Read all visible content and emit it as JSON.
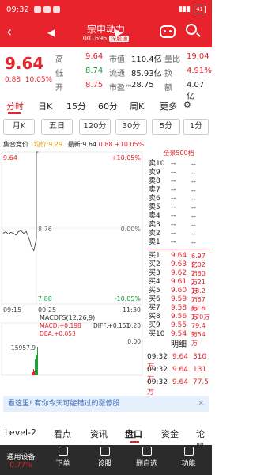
{
  "status": {
    "time": "09:32",
    "battery": "41"
  },
  "header": {
    "title": "宗申动力",
    "code": "001696",
    "tag": "深股通"
  },
  "quote": {
    "price": "9.64",
    "change": "0.88",
    "change_pct": "10.05%",
    "rows": [
      {
        "l1": "高",
        "v1": "9.64",
        "l2": "市值",
        "v2": "110.4亿",
        "l3": "量比",
        "v3": "19.04"
      },
      {
        "l1": "低",
        "v1": "8.74",
        "l2": "流通",
        "v2": "85.93亿",
        "l3": "换",
        "v3": "4.91%"
      },
      {
        "l1": "开",
        "v1": "8.75",
        "l2": "市盈™",
        "v2": "28.75",
        "l3": "额",
        "v3": "4.07亿"
      }
    ]
  },
  "tabs": [
    "分时",
    "日K",
    "15分",
    "60分",
    "周K",
    "更多"
  ],
  "periods": [
    "月K",
    "五日",
    "120分",
    "30分",
    "5分",
    "1分"
  ],
  "chart_info": {
    "auction": "集合竞价",
    "avg": "均价:9.29",
    "latest": "最新:9.64",
    "chg": "0.88",
    "pct": "+10.05%"
  },
  "chart_data": {
    "type": "line",
    "ylim": [
      7.88,
      9.64
    ],
    "y_labels": {
      "top": "9.64",
      "mid": "8.76",
      "bottom": "7.88"
    },
    "pct_labels": {
      "top": "+10.05%",
      "mid": "0.00%",
      "bottom": "-10.05%"
    },
    "x_labels": [
      "09:15",
      "09:25",
      "11:30"
    ],
    "series": [
      {
        "values": [
          8.7,
          8.72,
          8.69,
          8.71,
          8.7,
          8.68,
          8.72,
          8.73,
          8.7,
          8.72,
          8.65,
          8.55,
          8.5,
          8.63,
          9.64,
          9.64,
          9.64
        ]
      }
    ]
  },
  "volume": {
    "max": "15957.9",
    "label": "MACDFS(12,26,9)",
    "macd": "MACD:+0.198",
    "diff": "DIFF:+0.151",
    "dea": "DEA:+0.053",
    "v_top": "0.20",
    "v_zero": "0.00"
  },
  "book": {
    "header": "全景500档",
    "sells": [
      [
        "卖10",
        "--",
        "--"
      ],
      [
        "卖9",
        "--",
        "--"
      ],
      [
        "卖8",
        "--",
        "--"
      ],
      [
        "卖7",
        "--",
        "--"
      ],
      [
        "卖6",
        "--",
        "--"
      ],
      [
        "卖5",
        "--",
        "--"
      ],
      [
        "卖4",
        "--",
        "--"
      ],
      [
        "卖3",
        "--",
        "--"
      ],
      [
        "卖2",
        "--",
        "--"
      ],
      [
        "卖1",
        "--",
        "--"
      ]
    ],
    "buys": [
      [
        "买1",
        "9.64",
        "6.97亿"
      ],
      [
        "买2",
        "9.63",
        "2.02万"
      ],
      [
        "买3",
        "9.62",
        "2.60万"
      ],
      [
        "买4",
        "9.61",
        "2.21万"
      ],
      [
        "买5",
        "9.60",
        "18.2万"
      ],
      [
        "买6",
        "9.59",
        "7.67万"
      ],
      [
        "买7",
        "9.58",
        "62.6万"
      ],
      [
        "买8",
        "9.56",
        "170万"
      ],
      [
        "买9",
        "9.55",
        "79.4万"
      ],
      [
        "买10",
        "9.54",
        "9.54万"
      ]
    ]
  },
  "details": {
    "label": "明细",
    "rows": [
      [
        "09:32",
        "9.64",
        "310万"
      ],
      [
        "09:32",
        "9.64",
        "131万"
      ],
      [
        "09:32",
        "9.64",
        "77.5万"
      ]
    ]
  },
  "banner": "看这里! 有你今天可能错过的涨停股",
  "bottom_tabs": [
    "Level-2",
    "看点",
    "资讯",
    "盘口",
    "资金",
    "论股"
  ],
  "toolbar": [
    {
      "label": "通用设备",
      "sub": "0.77%"
    },
    {
      "label": "下单"
    },
    {
      "label": "诊股"
    },
    {
      "label": "删自选"
    },
    {
      "label": "功能"
    }
  ]
}
